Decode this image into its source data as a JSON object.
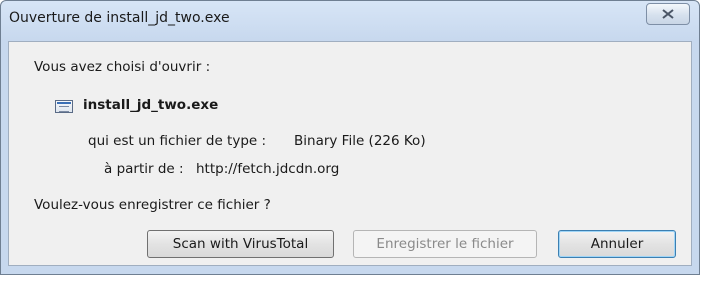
{
  "window": {
    "title": "Ouverture de install_jd_two.exe",
    "close_icon": "close-icon"
  },
  "dialog": {
    "intro": "Vous avez choisi d'ouvrir :",
    "file_icon": "executable-file-icon",
    "filename": "install_jd_two.exe",
    "type_label": "qui est un fichier de type :",
    "type_value": "Binary File (226 Ko)",
    "from_label": "à partir de :",
    "from_value": "http://fetch.jdcdn.org",
    "question": "Voulez-vous enregistrer ce fichier ?"
  },
  "buttons": {
    "scan": "Scan with VirusTotal",
    "save": "Enregistrer le fichier",
    "cancel": "Annuler"
  }
}
